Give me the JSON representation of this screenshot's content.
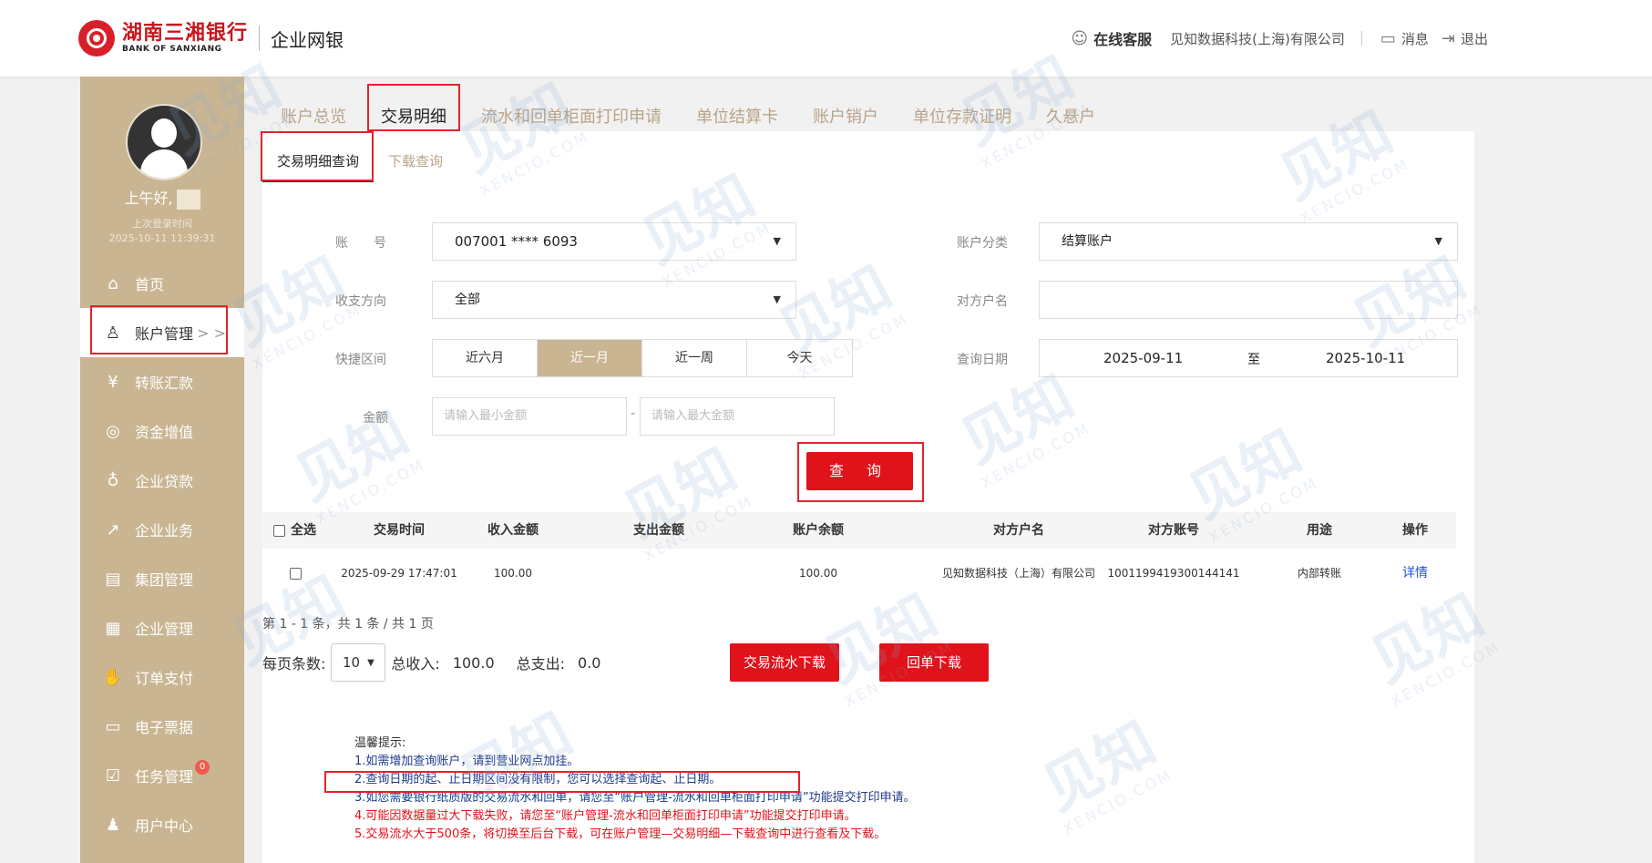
{
  "header": {
    "bank_name_cn": "湖南三湘银行",
    "bank_name_en": "BANK OF SANXIANG",
    "product": "企业网银",
    "service": "在线客服",
    "company": "见知数据科技(上海)有限公司",
    "messages": "消息",
    "logout": "退出"
  },
  "sidebar": {
    "greeting": "上午好,",
    "last_login_label": "上次登录时间",
    "last_login_time": "2025-10-11 11:39:31",
    "items": [
      {
        "label": "首页",
        "icon": "home-icon"
      },
      {
        "label": "账户管理",
        "icon": "user-icon",
        "active": true
      },
      {
        "label": "转账汇款",
        "icon": "transfer-icon"
      },
      {
        "label": "资金增值",
        "icon": "fund-icon"
      },
      {
        "label": "企业贷款",
        "icon": "loan-icon"
      },
      {
        "label": "企业业务",
        "icon": "business-icon"
      },
      {
        "label": "集团管理",
        "icon": "group-icon"
      },
      {
        "label": "企业管理",
        "icon": "company-icon"
      },
      {
        "label": "订单支付",
        "icon": "payment-icon"
      },
      {
        "label": "电子票据",
        "icon": "bill-icon"
      },
      {
        "label": "任务管理",
        "icon": "task-icon",
        "badge": "0"
      },
      {
        "label": "用户中心",
        "icon": "profile-icon"
      }
    ],
    "arrow": "> >"
  },
  "tabs": [
    "账户总览",
    "交易明细",
    "流水和回单柜面打印申请",
    "单位结算卡",
    "账户销户",
    "单位存款证明",
    "久悬户"
  ],
  "subtabs": [
    "交易明细查询",
    "下载查询"
  ],
  "form": {
    "account_label": "账　　号",
    "account_value": "007001 **** 6093",
    "category_label": "账户分类",
    "category_value": "结算账户",
    "direction_label": "收支方向",
    "direction_value": "全部",
    "counterparty_label": "对方户名",
    "quick_label": "快捷区间",
    "quick_options": [
      "近六月",
      "近一月",
      "近一周",
      "今天"
    ],
    "quick_selected": "近一月",
    "date_label": "查询日期",
    "date_from": "2025-09-11",
    "date_to_sep": "至",
    "date_to": "2025-10-11",
    "amount_label": "金额",
    "amount_min_placeholder": "请输入最小金额",
    "amount_sep": "-",
    "amount_max_placeholder": "请输入最大金额",
    "query_button": "查 询"
  },
  "table": {
    "headers": [
      "全选",
      "交易时间",
      "收入金额",
      "支出金额",
      "账户余额",
      "对方户名",
      "对方账号",
      "用途",
      "操作"
    ],
    "rows": [
      {
        "time": "2025-09-29 17:47:01",
        "income": "100.00",
        "expense": "",
        "balance": "100.00",
        "counterparty": "见知数据科技（上海）有限公司",
        "account": "1001199419300144141",
        "purpose": "内部转账",
        "action": "详情"
      }
    ]
  },
  "pagination": {
    "info": "第 1 - 1 条，共 1 条 / 共 1 页",
    "per_page_label": "每页条数:",
    "per_page": "10",
    "total_income_label": "总收入:",
    "total_income": "100.0",
    "total_expense_label": "总支出:",
    "total_expense": "0.0"
  },
  "buttons": {
    "download_flow": "交易流水下载",
    "download_receipt": "回单下载"
  },
  "tips": {
    "title": "温馨提示:",
    "lines": [
      "1.如需增加查询账户，请到营业网点加挂。",
      "2.查询日期的起、止日期区间没有限制，您可以选择查询起、止日期。",
      "3.如您需要银行纸质版的交易流水和回单，请您至“账户管理-流水和回单柜面打印申请”功能提交打印申请。",
      "4.可能因数据量过大下载失败，请您至“账户管理-流水和回单柜面打印申请”功能提交打印申请。",
      "5.交易流水大于500条，将切换至后台下载，可在账户管理—交易明细—下载查询中进行查看及下载。"
    ]
  },
  "watermark": {
    "text": "见知",
    "sub": "XENCIO.COM"
  },
  "colors": {
    "brand": "#d8202a",
    "sidebar": "#c9b592",
    "button": "#e0121a"
  }
}
